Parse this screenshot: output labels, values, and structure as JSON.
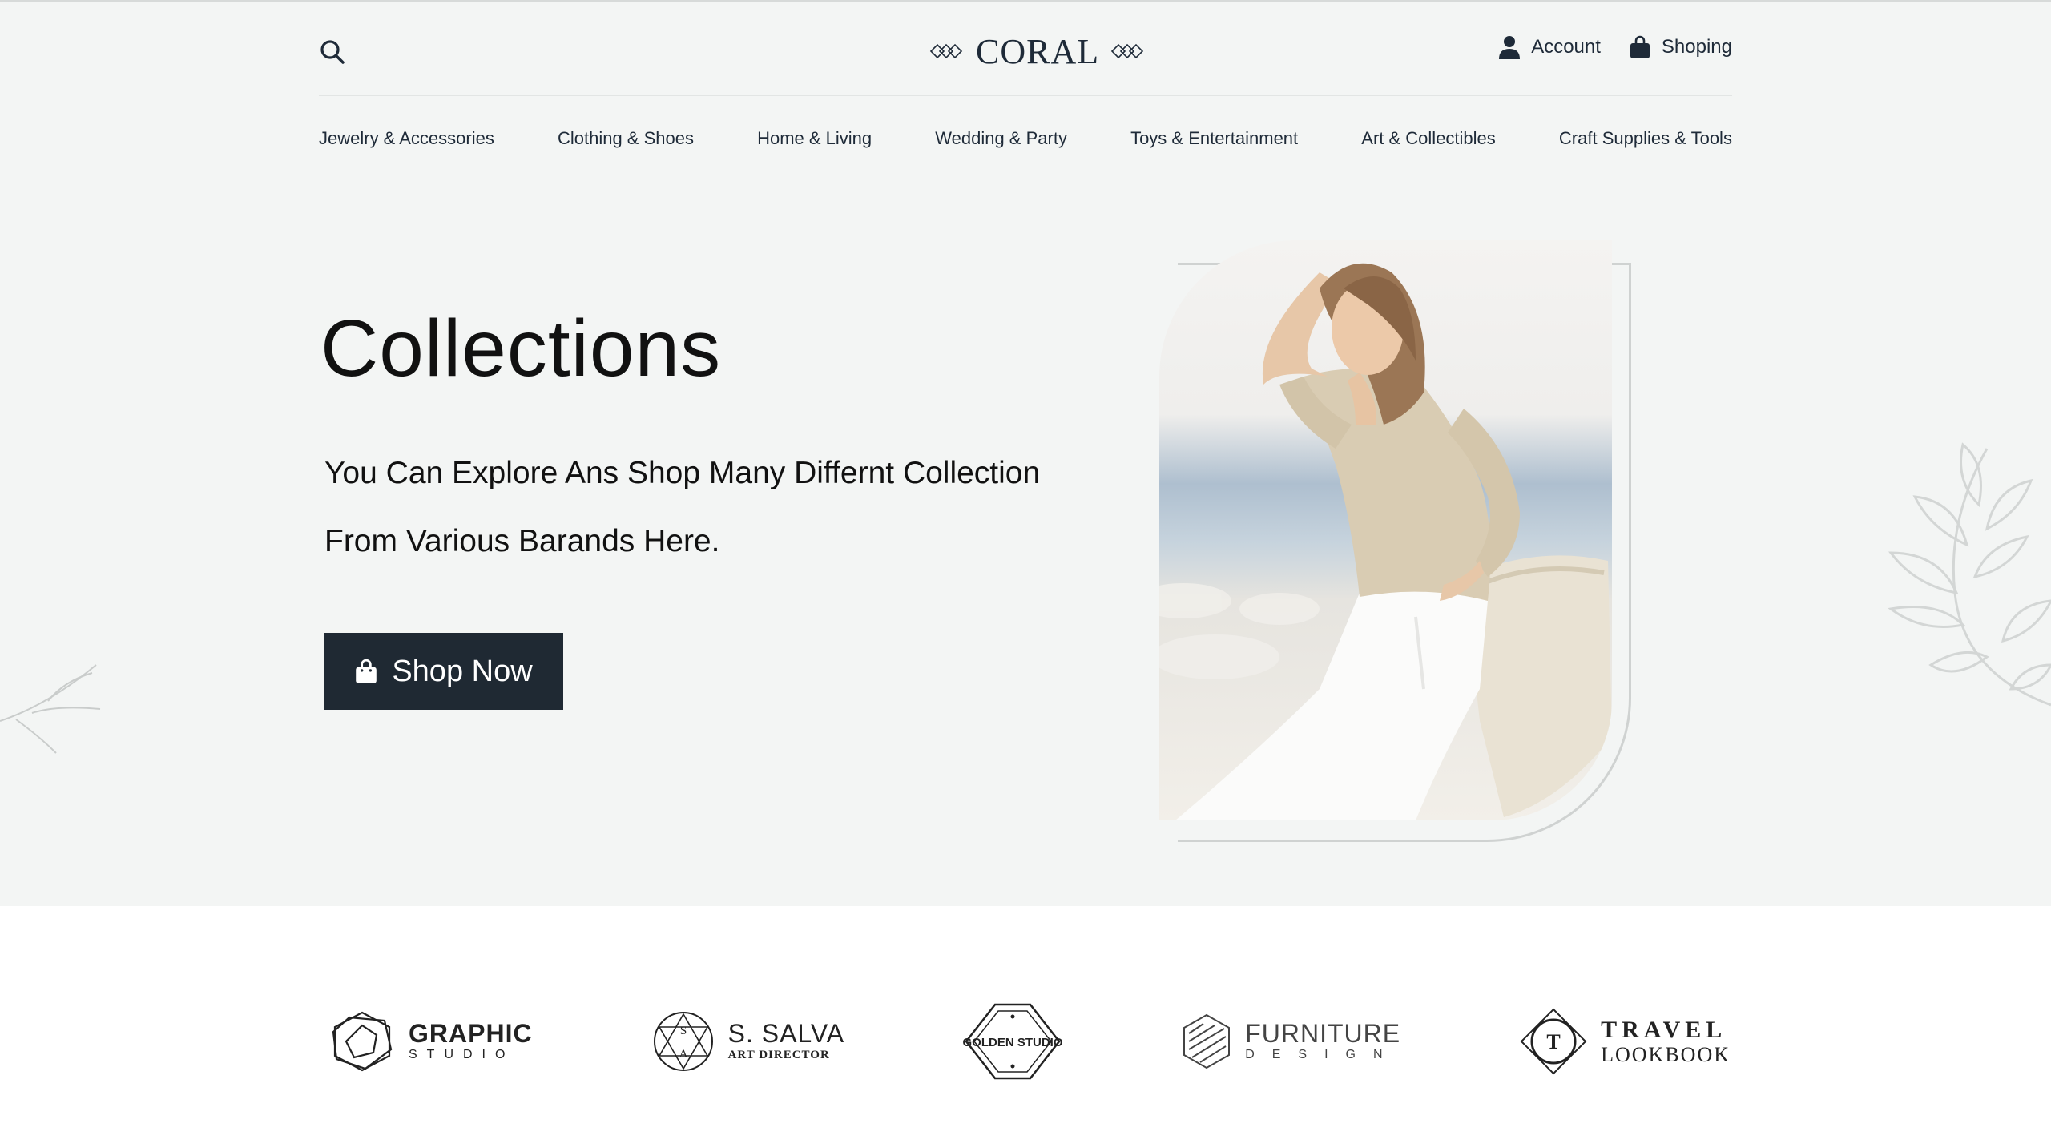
{
  "header": {
    "logo": "CORAL",
    "account_label": "Account",
    "shopping_label": "Shoping"
  },
  "nav": {
    "items": [
      "Jewelry & Accessories",
      "Clothing & Shoes",
      "Home & Living",
      "Wedding & Party",
      "Toys & Entertainment",
      "Art & Collectibles",
      "Craft Supplies & Tools"
    ]
  },
  "hero": {
    "title": "Collections",
    "subtitle_line1": "You Can Explore Ans Shop Many Differnt Collection",
    "subtitle_line2": "From Various Barands Here.",
    "button_label": "Shop Now"
  },
  "brands": [
    {
      "name": "GRAPHIC",
      "tag": "STUDIO"
    },
    {
      "name": "S. SALVA",
      "tag": "ART DIRECTOR",
      "monogram_top": "S",
      "monogram_bottom": "A"
    },
    {
      "name": "GOLDEN STUDIO"
    },
    {
      "name": "FURNITURE",
      "tag": "DESIGN"
    },
    {
      "name": "TRAVEL",
      "tag": "LOOKBOOK",
      "monogram": "T"
    }
  ],
  "colors": {
    "hero_background": "#f3f5f4",
    "button_background": "#1f2933",
    "text_dark": "#1e2a38"
  }
}
